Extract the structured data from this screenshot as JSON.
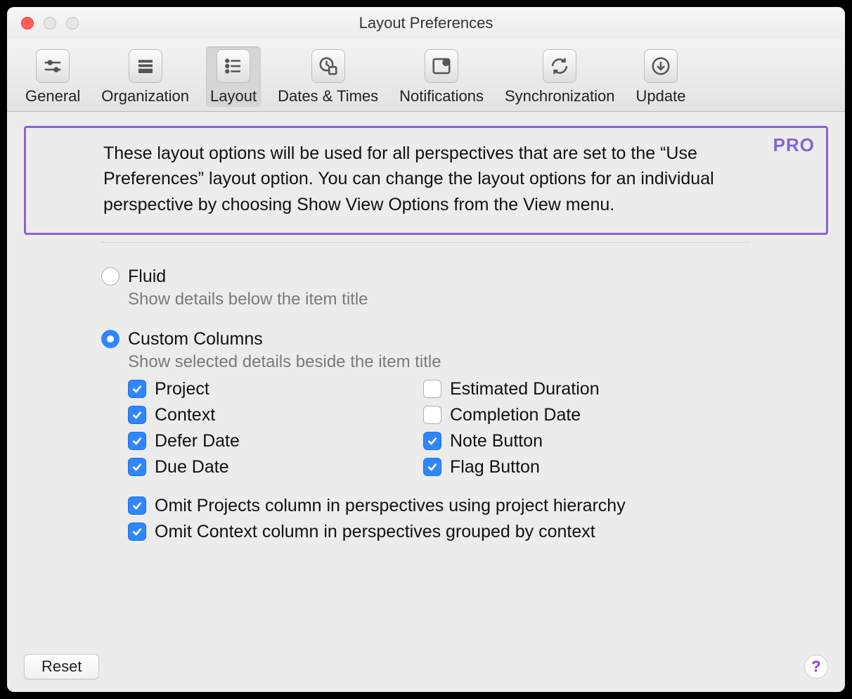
{
  "window": {
    "title": "Layout Preferences"
  },
  "toolbar": {
    "items": [
      {
        "label": "General"
      },
      {
        "label": "Organization"
      },
      {
        "label": "Layout"
      },
      {
        "label": "Dates & Times"
      },
      {
        "label": "Notifications"
      },
      {
        "label": "Synchronization"
      },
      {
        "label": "Update"
      }
    ],
    "selected_index": 2
  },
  "info": {
    "pro_badge": "PRO",
    "text": "These layout options will be used for all perspectives that are set to the “Use Preferences” layout option. You can change the layout options for an individual perspective by choosing Show View Options from the View menu."
  },
  "layout": {
    "fluid": {
      "label": "Fluid",
      "desc": "Show details below the item title",
      "selected": false
    },
    "custom": {
      "label": "Custom Columns",
      "desc": "Show selected details beside the item title",
      "selected": true
    },
    "columns_left": [
      {
        "label": "Project",
        "checked": true
      },
      {
        "label": "Context",
        "checked": true
      },
      {
        "label": "Defer Date",
        "checked": true
      },
      {
        "label": "Due Date",
        "checked": true
      }
    ],
    "columns_right": [
      {
        "label": "Estimated Duration",
        "checked": false
      },
      {
        "label": "Completion Date",
        "checked": false
      },
      {
        "label": "Note Button",
        "checked": true
      },
      {
        "label": "Flag Button",
        "checked": true
      }
    ],
    "omits": [
      {
        "label": "Omit Projects column in perspectives using project hierarchy",
        "checked": true
      },
      {
        "label": "Omit Context column in perspectives grouped by context",
        "checked": true
      }
    ]
  },
  "footer": {
    "reset": "Reset",
    "help": "?"
  }
}
